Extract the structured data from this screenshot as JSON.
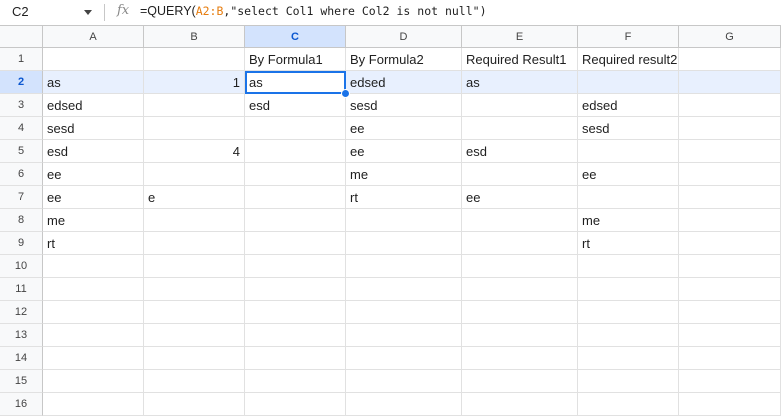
{
  "formula_bar": {
    "name_box": "C2",
    "fx_icon": "fx-icon",
    "formula_prefix": "=QUERY(",
    "formula_range": "A2:B",
    "formula_suffix": ",\"select Col1 where Col2 is not null\")"
  },
  "sheet": {
    "columns": [
      "A",
      "B",
      "C",
      "D",
      "E",
      "F",
      "G"
    ],
    "selected_column": "C",
    "rows": [
      "1",
      "2",
      "3",
      "4",
      "5",
      "6",
      "7",
      "8",
      "9",
      "10",
      "11",
      "12",
      "13",
      "14",
      "15",
      "16"
    ],
    "selected_row": "2",
    "cells": [
      {
        "ref": "C1",
        "value": "By Formula1"
      },
      {
        "ref": "D1",
        "value": "By Formula2"
      },
      {
        "ref": "E1",
        "value": "Required Result1"
      },
      {
        "ref": "F1",
        "value": "Required result2"
      },
      {
        "ref": "A2",
        "value": "as"
      },
      {
        "ref": "B2",
        "value": "1",
        "numeric": true
      },
      {
        "ref": "C2",
        "value": "as",
        "active": true
      },
      {
        "ref": "D2",
        "value": "edsed"
      },
      {
        "ref": "E2",
        "value": "as"
      },
      {
        "ref": "A3",
        "value": "edsed"
      },
      {
        "ref": "C3",
        "value": "esd"
      },
      {
        "ref": "D3",
        "value": "sesd"
      },
      {
        "ref": "F3",
        "value": "edsed"
      },
      {
        "ref": "A4",
        "value": "sesd"
      },
      {
        "ref": "D4",
        "value": "ee"
      },
      {
        "ref": "F4",
        "value": "sesd"
      },
      {
        "ref": "A5",
        "value": "esd"
      },
      {
        "ref": "B5",
        "value": "4",
        "numeric": true
      },
      {
        "ref": "D5",
        "value": "ee"
      },
      {
        "ref": "E5",
        "value": "esd"
      },
      {
        "ref": "A6",
        "value": "ee"
      },
      {
        "ref": "D6",
        "value": "me"
      },
      {
        "ref": "F6",
        "value": "ee"
      },
      {
        "ref": "A7",
        "value": "ee"
      },
      {
        "ref": "B7",
        "value": "e"
      },
      {
        "ref": "D7",
        "value": "rt"
      },
      {
        "ref": "E7",
        "value": "ee"
      },
      {
        "ref": "A8",
        "value": "me"
      },
      {
        "ref": "F8",
        "value": "me"
      },
      {
        "ref": "A9",
        "value": "rt"
      },
      {
        "ref": "F9",
        "value": "rt"
      }
    ]
  }
}
